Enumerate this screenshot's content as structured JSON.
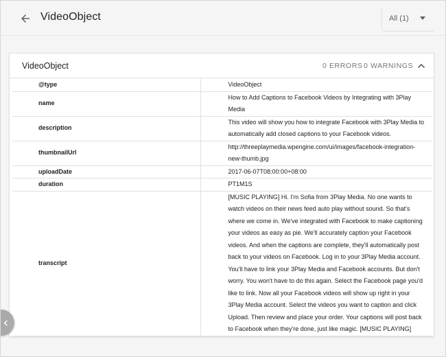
{
  "header": {
    "title": "VideoObject",
    "filter_label": "All (1)"
  },
  "card": {
    "title": "VideoObject",
    "errors": "0 ERRORS",
    "warnings": "0 WARNINGS"
  },
  "properties": [
    {
      "key": "@type",
      "value": "VideoObject"
    },
    {
      "key": "name",
      "value": "How to Add Captions to Facebook Videos by Integrating with 3Play Media"
    },
    {
      "key": "description",
      "value": "This video will show you how to integrate Facebook with 3Play Media to automatically add closed captions to your Facebook videos."
    },
    {
      "key": "thumbnailUrl",
      "value": "http://threeplaymedia.wpengine.com/ui/images/facebook-integration-new-thumb.jpg"
    },
    {
      "key": "uploadDate",
      "value": "2017-06-07T08:00:00+08:00"
    },
    {
      "key": "duration",
      "value": "PT1M1S"
    },
    {
      "key": "transcript",
      "value": "[MUSIC PLAYING] Hi. I'm Sofia from 3Play Media. No one wants to watch videos on their news feed auto play without sound. So that's where we come in. We've integrated with Facebook to make captioning your videos as easy as pie. We'll accurately caption your Facebook videos. And when the captions are complete, they'll automatically post back to your videos on Facebook. Log in to your 3Play Media account. You'll have to link your 3Play Media and Facebook accounts. But don't worry. You won't have to do this again. Select the Facebook page you'd like to link. Now all your Facebook videos will show up right in your 3Play Media account. Select the videos you want to caption and click Upload. Then review and place your order. Your captions will post back to Facebook when they're done, just like magic. [MUSIC PLAYING]"
    }
  ]
}
